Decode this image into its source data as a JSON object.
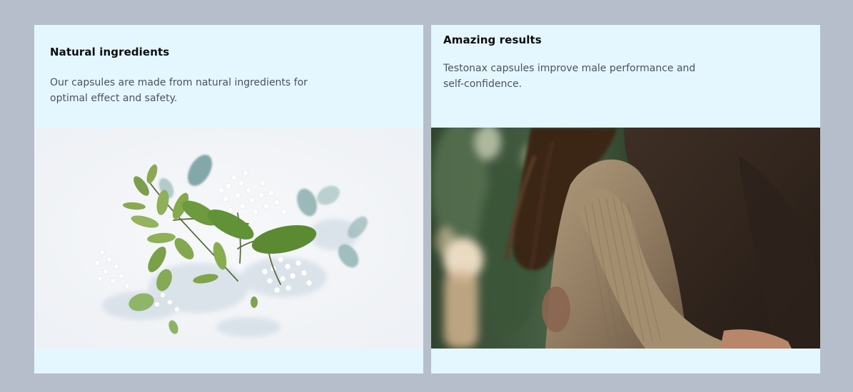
{
  "cards": [
    {
      "title": "Natural ingredients",
      "description": "Our capsules are made from natural ingredients for optimal effect and safety."
    },
    {
      "title": "Amazing results",
      "description": "Testonax capsules improve male performance and self-confidence."
    }
  ]
}
